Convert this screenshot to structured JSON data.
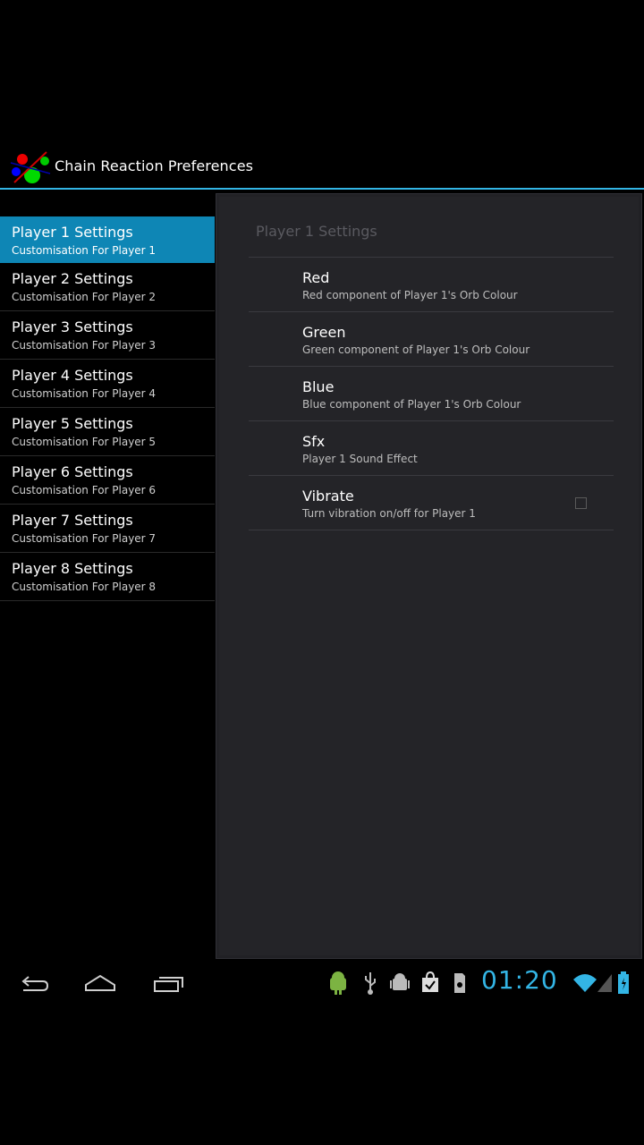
{
  "app": {
    "title": "Chain Reaction Preferences"
  },
  "headers": [
    {
      "title": "Player 1 Settings",
      "summary": "Customisation For Player 1",
      "selected": true
    },
    {
      "title": "Player 2 Settings",
      "summary": "Customisation For Player 2"
    },
    {
      "title": "Player 3 Settings",
      "summary": "Customisation For Player 3"
    },
    {
      "title": "Player 4 Settings",
      "summary": "Customisation For Player 4"
    },
    {
      "title": "Player 5 Settings",
      "summary": "Customisation For Player 5"
    },
    {
      "title": "Player 6 Settings",
      "summary": "Customisation For Player 6"
    },
    {
      "title": "Player 7 Settings",
      "summary": "Customisation For Player 7"
    },
    {
      "title": "Player 8 Settings",
      "summary": "Customisation For Player 8"
    }
  ],
  "detail": {
    "breadcrumb": "Player 1 Settings",
    "prefs": [
      {
        "title": "Red",
        "summary": "Red component of Player 1's Orb Colour"
      },
      {
        "title": "Green",
        "summary": "Green component of Player 1's Orb Colour"
      },
      {
        "title": "Blue",
        "summary": "Blue component of Player 1's Orb Colour"
      },
      {
        "title": "Sfx",
        "summary": "Player 1 Sound Effect"
      },
      {
        "title": "Vibrate",
        "summary": "Turn vibration on/off for Player 1",
        "checked": false
      }
    ]
  },
  "system_bar": {
    "time": "01:20",
    "nav": [
      "back-icon",
      "home-icon",
      "recent-apps-icon"
    ],
    "status_icons": [
      "android-debug-icon",
      "usb-icon",
      "android-icon",
      "shopping-bag-icon",
      "sd-card-icon",
      "wifi-icon",
      "signal-icon",
      "battery-icon"
    ]
  },
  "colors": {
    "accent": "#33b5e5",
    "selected": "#0e86b5"
  }
}
